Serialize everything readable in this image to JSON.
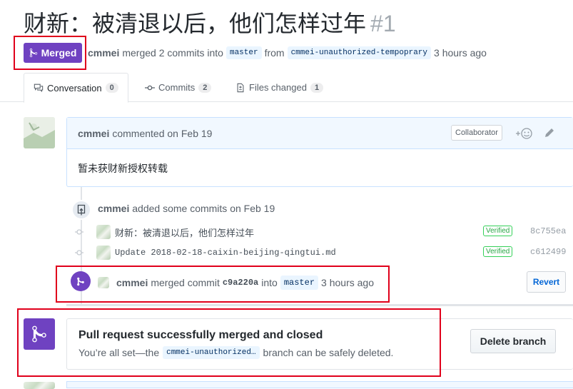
{
  "pr": {
    "title": "财新：被清退以后，他们怎样过年",
    "number": "#1",
    "state_label": "Merged",
    "author": "cmmei",
    "merged_text": "merged 2 commits into",
    "base_branch": "master",
    "from_text": "from",
    "head_branch": "cmmei-unauthorized-tempoprary",
    "time": "3 hours ago"
  },
  "tabs": [
    {
      "label": "Conversation",
      "count": "0"
    },
    {
      "label": "Commits",
      "count": "2"
    },
    {
      "label": "Files changed",
      "count": "1"
    }
  ],
  "comment": {
    "author": "cmmei",
    "action": "commented on Feb 19",
    "role": "Collaborator",
    "body": "暂未获财新授权转载"
  },
  "commits_event": {
    "author": "cmmei",
    "text": "added some commits on Feb 19"
  },
  "commits": [
    {
      "message": "财新：被清退以后，他们怎样过年",
      "verified": "Verified",
      "sha": "8c755ea"
    },
    {
      "message": "Update 2018-02-18-caixin-beijing-qingtui.md",
      "verified": "Verified",
      "sha": "c612499"
    }
  ],
  "merge_event": {
    "author": "cmmei",
    "text": "merged commit",
    "sha": "c9a220a",
    "into": "into",
    "branch": "master",
    "time": "3 hours ago",
    "revert_label": "Revert"
  },
  "merge_box": {
    "title": "Pull request successfully merged and closed",
    "desc_prefix": "You’re all set—the",
    "branch": "cmmei-unauthorized…",
    "desc_suffix": "branch can be safely deleted.",
    "delete_label": "Delete branch"
  },
  "colors": {
    "merged_purple": "#6f42c1",
    "annotation_red": "#e0001b",
    "link_blue": "#0366d6",
    "verified_green": "#28a745"
  }
}
